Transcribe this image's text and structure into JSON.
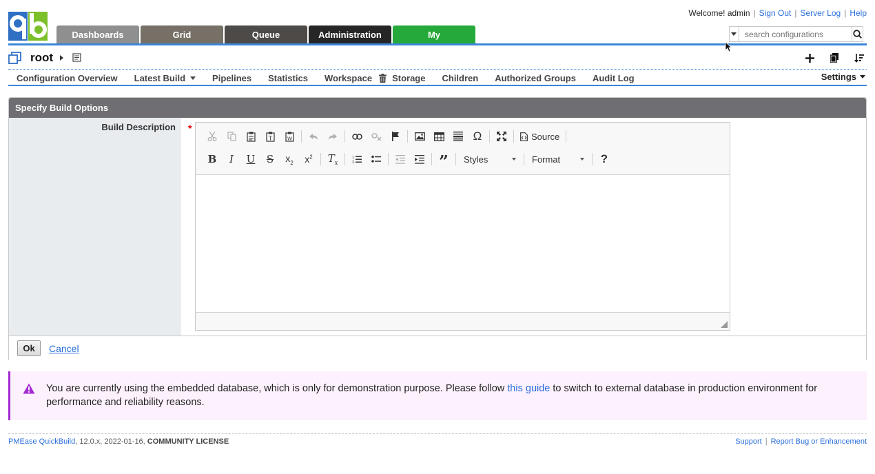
{
  "header": {
    "tabs": [
      {
        "label": "Dashboards"
      },
      {
        "label": "Grid"
      },
      {
        "label": "Queue"
      },
      {
        "label": "Administration"
      },
      {
        "label": "My"
      }
    ],
    "welcome": "Welcome! admin",
    "links": {
      "sign_out": "Sign Out",
      "server_log": "Server Log",
      "help": "Help"
    },
    "search": {
      "placeholder": "search configurations"
    }
  },
  "config": {
    "name": "root"
  },
  "subnav": {
    "items": [
      "Configuration Overview",
      "Latest Build",
      "Pipelines",
      "Statistics",
      "Workspace",
      "Storage",
      "Children",
      "Authorized Groups",
      "Audit Log"
    ],
    "settings": "Settings"
  },
  "panel": {
    "title": "Specify Build Options",
    "field_label": "Build Description",
    "required_mark": "*",
    "editor": {
      "source_label": "Source",
      "styles_label": "Styles",
      "format_label": "Format",
      "help_label": "?"
    },
    "ok_label": "Ok",
    "cancel_label": "Cancel"
  },
  "alert": {
    "text_before": "You are currently using the embedded database, which is only for demonstration purpose. Please follow ",
    "link": "this guide",
    "text_after": " to switch to external database in production environment for performance and reliability reasons."
  },
  "footer": {
    "product": "PMEase QuickBuild",
    "version": ", 12.0.x, 2022-01-16, ",
    "license": "COMMUNITY LICENSE",
    "support": "Support",
    "report": "Report Bug or Enhancement"
  },
  "colors": {
    "accent": "#3a86d9",
    "my_tab": "#25a93a",
    "alert_border": "#a52bd3"
  }
}
